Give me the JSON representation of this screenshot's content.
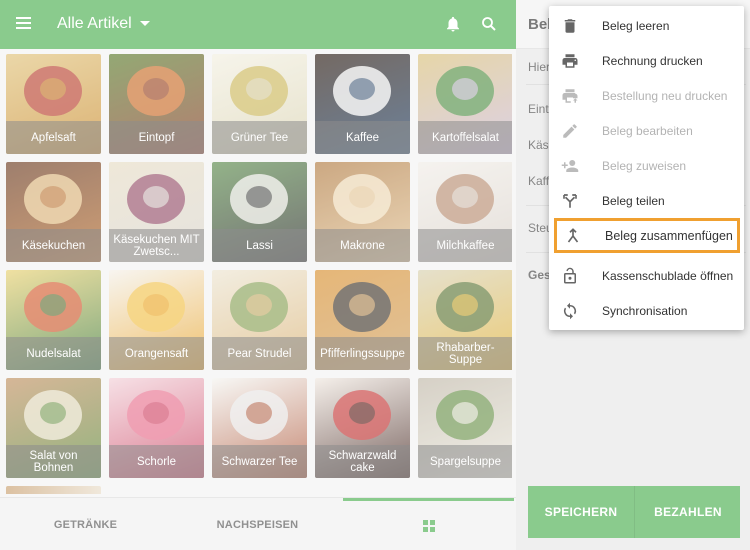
{
  "topbar": {
    "title": "Alle Artikel",
    "menu_icon": "hamburger-icon",
    "notification_icon": "bell-icon",
    "search_icon": "search-icon",
    "color": "#4caf50"
  },
  "products": [
    {
      "name": "Apfelsaft",
      "colors": [
        "#c98a2a",
        "#b5322a",
        "#e0c27a"
      ]
    },
    {
      "name": "Eintopf",
      "colors": [
        "#8a3a24",
        "#d9702a",
        "#5a7a2a"
      ]
    },
    {
      "name": "Grüner Tee",
      "colors": [
        "#d9d2b0",
        "#c7b04a",
        "#f2efe0"
      ]
    },
    {
      "name": "Kaffee",
      "colors": [
        "#1f3e63",
        "#f2f2f2",
        "#2a1a10"
      ]
    },
    {
      "name": "Kartoffelsalat",
      "colors": [
        "#c9b8d6",
        "#3f8a3a",
        "#d9c07a"
      ]
    },
    {
      "name": "Käsekuchen",
      "colors": [
        "#b56a2a",
        "#e8c48a",
        "#6a3a20"
      ]
    },
    {
      "name": "Käsekuchen MIT Zwetsc...",
      "colors": [
        "#d8d4cc",
        "#8a3a5a",
        "#e6dcc4"
      ]
    },
    {
      "name": "Lassi",
      "colors": [
        "#2a2a2a",
        "#e8e8e0",
        "#5a8a4a"
      ]
    },
    {
      "name": "Makrone",
      "colors": [
        "#e0c090",
        "#f2e0c0",
        "#b07a40"
      ]
    },
    {
      "name": "Milchkaffee",
      "colors": [
        "#d8d0c8",
        "#b08060",
        "#f0ece6"
      ]
    },
    {
      "name": "Nudelsalat",
      "colors": [
        "#3a7a3a",
        "#d8502a",
        "#e8d070"
      ]
    },
    {
      "name": "Orangensaft",
      "colors": [
        "#e8a020",
        "#f2c040",
        "#f4f0e8"
      ]
    },
    {
      "name": "Pear Strudel",
      "colors": [
        "#d8b070",
        "#7a9a4a",
        "#ece4d0"
      ]
    },
    {
      "name": "Pfifferlingssuppe",
      "colors": [
        "#d0a060",
        "#2a2a2a",
        "#d89030"
      ]
    },
    {
      "name": "Rhabarber-Suppe",
      "colors": [
        "#e0b030",
        "#4a6a2a",
        "#d8d0b0"
      ]
    },
    {
      "name": "Salat von Bohnen",
      "colors": [
        "#5a8a3a",
        "#e8e0c8",
        "#c09060"
      ]
    },
    {
      "name": "Schorle",
      "colors": [
        "#c83a5a",
        "#e86a8a",
        "#f2d0d8"
      ]
    },
    {
      "name": "Schwarzer Tee",
      "colors": [
        "#a84a2a",
        "#e8e8e8",
        "#f4f4f0"
      ]
    },
    {
      "name": "Schwarzwald cake",
      "colors": [
        "#3a1a14",
        "#c82a2a",
        "#f0e8e0"
      ]
    },
    {
      "name": "Spargelsuppe",
      "colors": [
        "#e8e4d8",
        "#5a8a3a",
        "#c0b8a8"
      ]
    }
  ],
  "bottomnav": {
    "tabs": [
      "GETRÄNKE",
      "NACHSPEISEN"
    ],
    "active_tab_icon": "grid-icon"
  },
  "receipt": {
    "title": "Beleg",
    "lines": [
      "Hier",
      "Eint",
      "Käse",
      "Kaff",
      "Steu",
      "Ges"
    ],
    "save_label": "SPEICHERN",
    "pay_label": "BEZAHLEN"
  },
  "menu": {
    "items": [
      {
        "label": "Beleg leeren",
        "icon": "trash-icon",
        "enabled": true
      },
      {
        "label": "Rechnung drucken",
        "icon": "printer-icon",
        "enabled": true
      },
      {
        "label": "Bestellung neu drucken",
        "icon": "reprint-icon",
        "enabled": false
      },
      {
        "label": "Beleg bearbeiten",
        "icon": "pencil-icon",
        "enabled": false
      },
      {
        "label": "Beleg zuweisen",
        "icon": "assign-user-icon",
        "enabled": false
      },
      {
        "label": "Beleg teilen",
        "icon": "split-icon",
        "enabled": true
      },
      {
        "label": "Beleg zusammenfügen",
        "icon": "merge-icon",
        "enabled": true,
        "highlighted": true
      },
      {
        "label": "Kassenschublade öffnen",
        "icon": "unlock-icon",
        "enabled": true
      },
      {
        "label": "Synchronisation",
        "icon": "sync-icon",
        "enabled": true
      }
    ],
    "highlight_color": "#f0a030"
  }
}
